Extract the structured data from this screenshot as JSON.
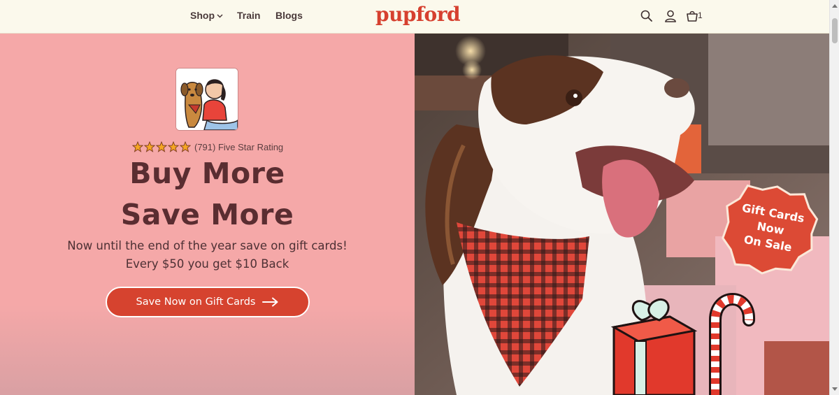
{
  "header": {
    "nav": [
      {
        "label": "Shop"
      },
      {
        "label": "Train"
      },
      {
        "label": "Blogs"
      }
    ],
    "logo": "pupford",
    "cart_count": "1",
    "icons": [
      "search-icon",
      "account-icon",
      "cart-icon"
    ]
  },
  "hero": {
    "rating_text": "(791) Five Star Rating",
    "stars": 5,
    "headline_line1": "Buy More",
    "headline_line2": "Save More",
    "sub_line1": "Now until the end of the year save on gift cards!",
    "sub_line2": "Every $50 you get $10 Back",
    "cta_label": "Save Now on Gift Cards",
    "sticker": {
      "line1": "Gift Cards",
      "line2": "Now",
      "line3": "On Sale"
    }
  },
  "colors": {
    "brand": "#d6402f",
    "hero_bg": "#f5a8a8",
    "headline": "#5a2d31",
    "header_bg": "#fbf9ec"
  }
}
